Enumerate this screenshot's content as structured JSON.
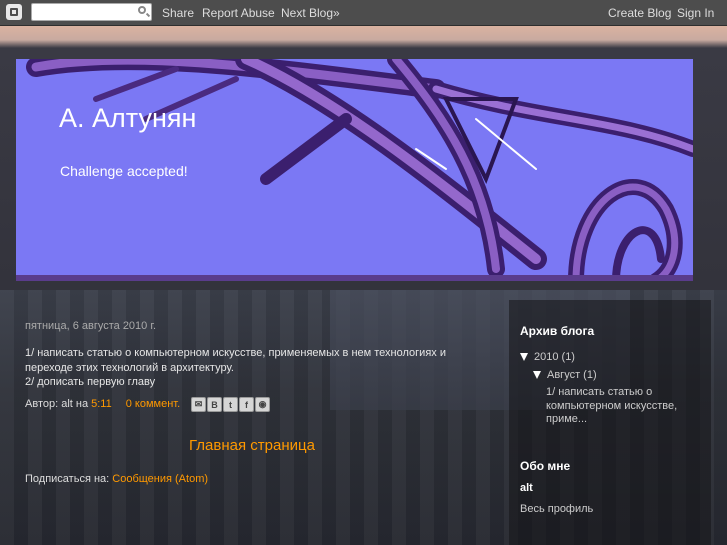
{
  "navbar": {
    "share": "Share",
    "report_abuse": "Report Abuse",
    "next_blog": "Next Blog»",
    "create_blog": "Create Blog",
    "sign_in": "Sign In",
    "search_placeholder": ""
  },
  "header": {
    "title": "А. Алтунян",
    "description": "Challenge accepted!"
  },
  "post": {
    "date": "пятница, 6 августа 2010 г.",
    "line1": "1/ написать статью о компьютерном искусстве, применяемых в нем технологиях и переходе этих технологий в архитектуру.",
    "line2": "2/ дописать первую главу",
    "author_label": "Автор: alt на ",
    "time": "5:11",
    "comments": "0 коммент."
  },
  "home_link": "Главная страница",
  "subscribe": {
    "label": "Подписаться на: ",
    "link": "Сообщения (Atom)"
  },
  "sidebar": {
    "archive_title": "Архив блога",
    "year": "2010 (1)",
    "month": "Август (1)",
    "post_link": "1/ написать статью о компьютерном искусстве, приме...",
    "about_title": "Обо мне",
    "author": "alt",
    "profile_link": "Весь профиль"
  },
  "colors": {
    "link": "#ff9900",
    "header_bg": "#7b78f4",
    "navbar_bg": "#4d4d4d"
  }
}
